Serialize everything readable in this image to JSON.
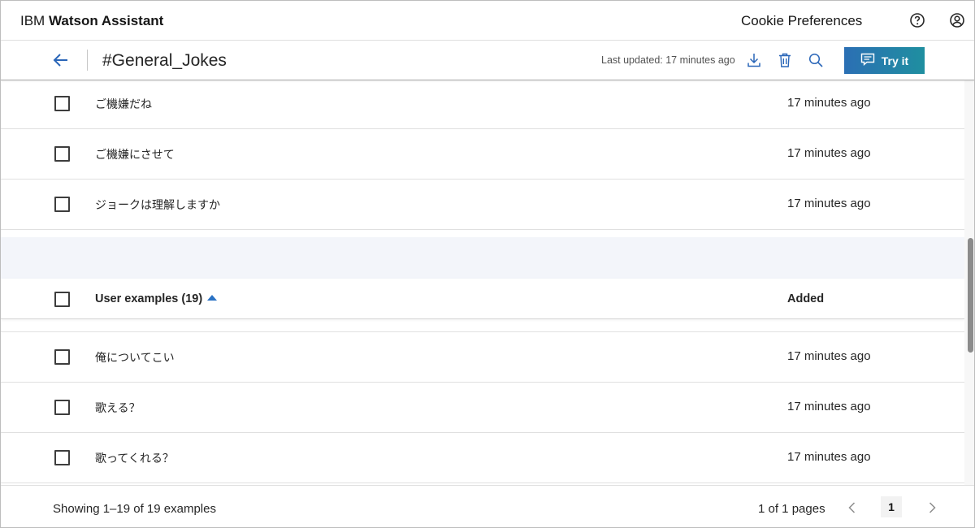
{
  "header": {
    "brand_prefix": "IBM",
    "brand_name": "Watson Assistant",
    "cookie_label": "Cookie Preferences",
    "icons": [
      "help-icon",
      "user-profile-icon"
    ]
  },
  "toolbar": {
    "intent_title": "#General_Jokes",
    "last_updated": "Last updated: 17 minutes ago",
    "try_label": "Try it",
    "accent_color": "#2b6fb4",
    "icons": [
      "back-arrow-icon",
      "download-icon",
      "trash-icon",
      "search-icon",
      "chat-icon"
    ]
  },
  "table": {
    "rows_top": [
      {
        "example": "ご機嫌だね",
        "added": "17 minutes ago"
      },
      {
        "example": "ご機嫌にさせて",
        "added": "17 minutes ago"
      },
      {
        "example": "ジョークは理解しますか",
        "added": "17 minutes ago"
      }
    ],
    "column_examples": "User examples (19)",
    "column_added": "Added",
    "rows_bottom": [
      {
        "example": "俺についてこい",
        "added": "17 minutes ago"
      },
      {
        "example": "歌える？",
        "added": "17 minutes ago"
      },
      {
        "example": "歌ってくれる？",
        "added": "17 minutes ago"
      }
    ]
  },
  "footer": {
    "showing": "Showing 1–19 of 19 examples",
    "pages": "1 of 1 pages",
    "current_page": "1"
  }
}
